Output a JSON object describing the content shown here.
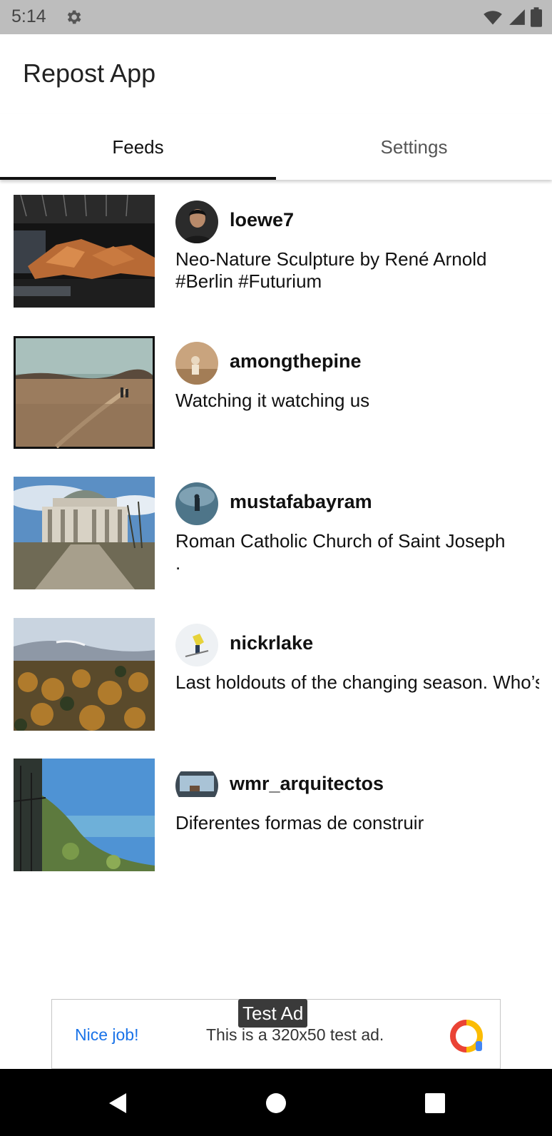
{
  "status_bar": {
    "time": "5:14",
    "icons": [
      "gear-icon",
      "wifi-icon",
      "signal-icon",
      "battery-icon"
    ]
  },
  "app": {
    "title": "Repost App"
  },
  "tabs": [
    {
      "label": "Feeds",
      "active": true
    },
    {
      "label": "Settings",
      "active": false
    }
  ],
  "feed": [
    {
      "username": "loewe7",
      "caption": "Neo-Nature Sculpture by René Arnold\n#Berlin #Futurium"
    },
    {
      "username": "amongthepine",
      "caption": "Watching it watching us"
    },
    {
      "username": "mustafabayram",
      "caption": "Roman Catholic Church of Saint Joseph\n."
    },
    {
      "username": "nickrlake",
      "caption": "Last holdouts of the changing season.\nWho’s trading out autumn golds for twink"
    },
    {
      "username": "wmr_arquitectos",
      "caption": "Diferentes formas de construir"
    }
  ],
  "ad": {
    "tag": "Test Ad",
    "left_text": "Nice job!",
    "center_text": "This is a 320x50 test ad."
  },
  "nav": {
    "buttons": [
      "back-icon",
      "home-icon",
      "recents-icon"
    ]
  },
  "colors": {
    "status_bar": "#bdbdbd",
    "tab_indicator": "#111111",
    "ad_link": "#1a73e8",
    "nav_bar": "#000000"
  }
}
